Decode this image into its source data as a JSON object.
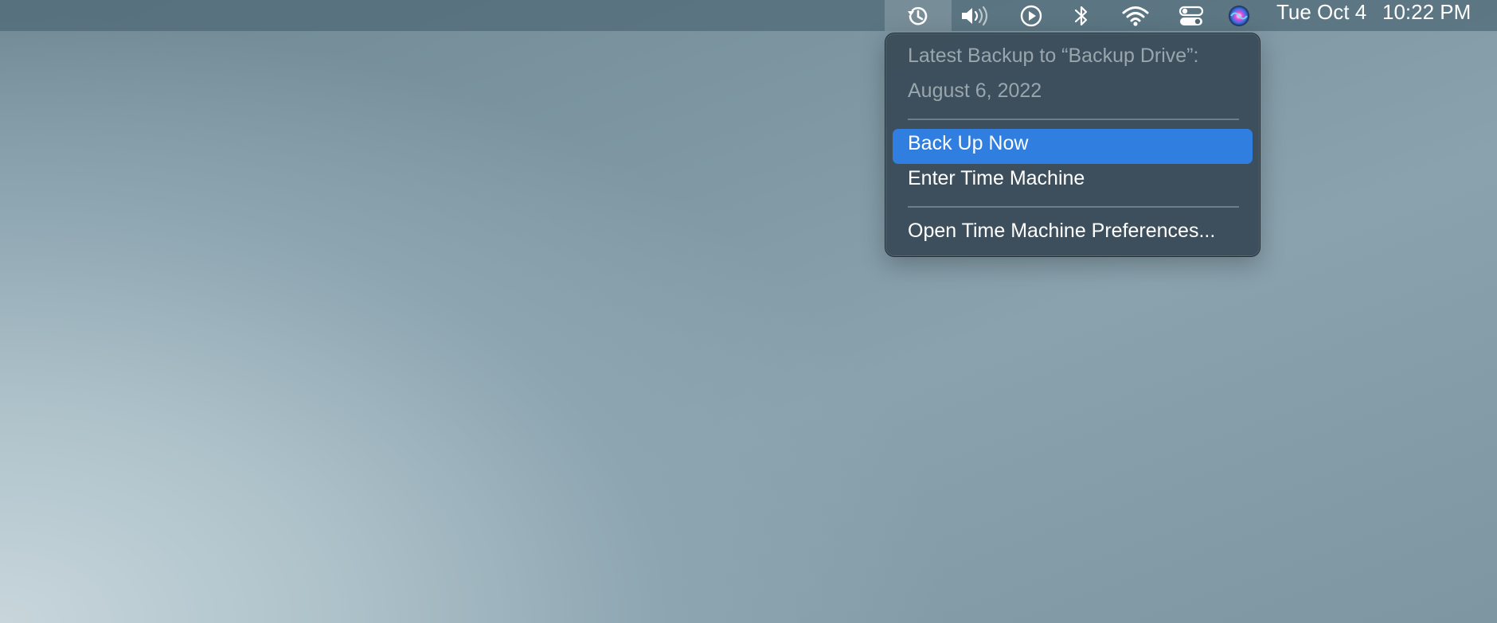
{
  "menubar": {
    "icons": {
      "time_machine": "time-machine-icon",
      "volume": "volume-icon",
      "now_playing": "play-circle-icon",
      "bluetooth": "bluetooth-icon",
      "wifi": "wifi-icon",
      "control_center": "control-center-icon",
      "siri": "siri-icon"
    },
    "date": "Tue Oct 4",
    "time": "10:22 PM"
  },
  "time_machine_menu": {
    "latest_backup_label": "Latest Backup to “Backup Drive”:",
    "latest_backup_date": "August 6, 2022",
    "items": [
      {
        "label": "Back Up Now",
        "highlighted": true
      },
      {
        "label": "Enter Time Machine",
        "highlighted": false
      },
      {
        "label": "Open Time Machine Preferences..."
      }
    ]
  },
  "colors": {
    "highlight": "#2f7ee0",
    "menu_background": "#3a4c58",
    "disabled_text": "#9aa6ae"
  }
}
